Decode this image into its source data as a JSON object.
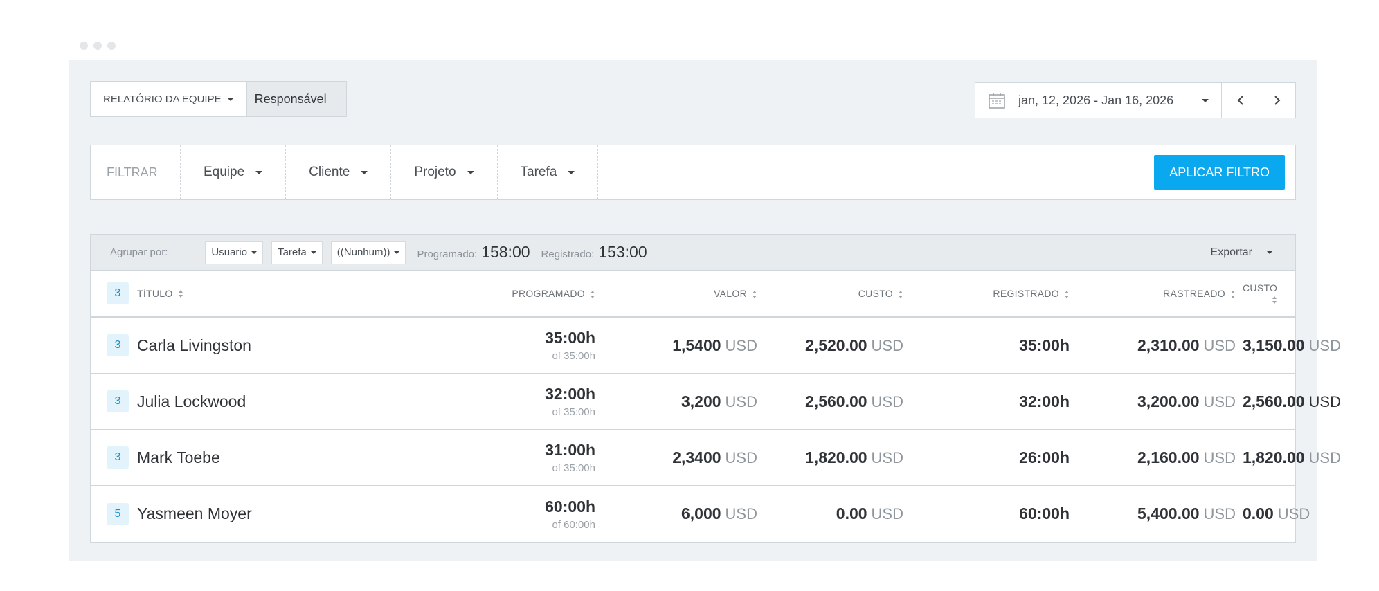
{
  "header": {
    "report_label": "RELATÓRIO DA EQUIPE",
    "responsavel_label": "Responsável",
    "date_range": "jan, 12, 2026 - Jan 16, 2026"
  },
  "filter": {
    "label": "FILTRAR",
    "items": [
      "Equipe",
      "Cliente",
      "Projeto",
      "Tarefa"
    ],
    "apply_label": "APLICAR FILTRO"
  },
  "group_bar": {
    "label": "Agrupar por:",
    "selects": [
      "Usuario",
      "Tarefa",
      "((Nunhum))"
    ],
    "scheduled_label": "Programado:",
    "scheduled_value": "158:00",
    "registered_label": "Registrado:",
    "registered_value": "153:00",
    "export_label": "Exportar"
  },
  "table": {
    "header_badge": "3",
    "columns": [
      "TÍTULO",
      "PROGRAMADO",
      "VALOR",
      "CUSTO",
      "REGISTRADO",
      "RASTREADO",
      "CUSTO"
    ],
    "unit": "USD",
    "rows": [
      {
        "badge": "3",
        "name": "Carla Livingston",
        "scheduled": "35:00h",
        "scheduled_of": "of 35:00h",
        "valor": "1,5400",
        "custo": "2,520.00",
        "registrado": "35:00h",
        "rastreado": "2,310.00",
        "custo2": "3,150.00"
      },
      {
        "badge": "3",
        "name": "Julia Lockwood",
        "scheduled": "32:00h",
        "scheduled_of": "of 35:00h",
        "valor": "3,200",
        "custo": "2,560.00",
        "registrado": "32:00h",
        "rastreado": "3,200.00",
        "custo2": "2,560.00"
      },
      {
        "badge": "3",
        "name": "Mark Toebe",
        "scheduled": "31:00h",
        "scheduled_of": "of 35:00h",
        "valor": "2,3400",
        "custo": "1,820.00",
        "registrado": "26:00h",
        "rastreado": "2,160.00",
        "custo2": "1,820.00"
      },
      {
        "badge": "5",
        "name": "Yasmeen Moyer",
        "scheduled": "60:00h",
        "scheduled_of": "of 60:00h",
        "valor": "6,000",
        "custo": "0.00",
        "registrado": "60:00h",
        "rastreado": "5,400.00",
        "custo2": "0.00"
      }
    ]
  },
  "icons": {
    "calendar": "calendar-icon",
    "prev": "chevron-left-icon",
    "next": "chevron-right-icon"
  }
}
